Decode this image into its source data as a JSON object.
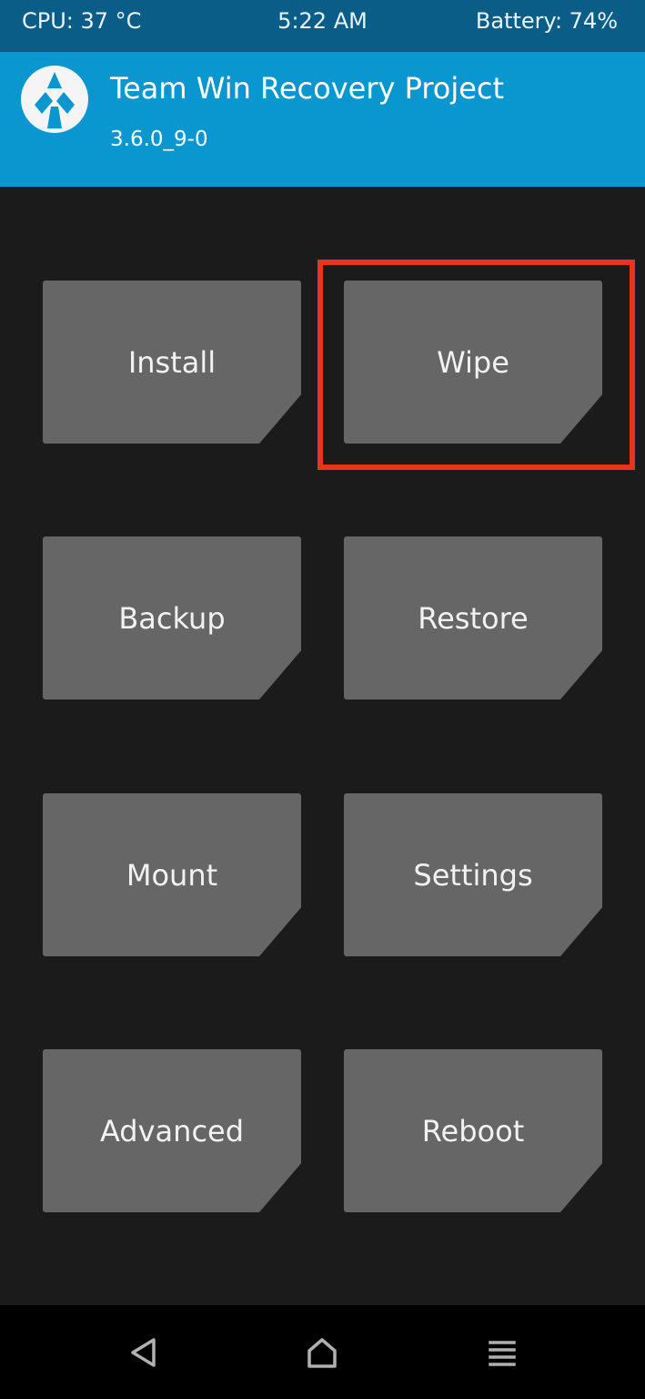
{
  "status_bar": {
    "cpu": "CPU: 37 °C",
    "time": "5:22 AM",
    "battery": "Battery: 74%"
  },
  "header": {
    "logo_icon": "twrp-logo-icon",
    "title": "Team Win Recovery Project",
    "version": "3.6.0_9-0"
  },
  "menu": {
    "install": "Install",
    "wipe": "Wipe",
    "backup": "Backup",
    "restore": "Restore",
    "mount": "Mount",
    "settings": "Settings",
    "advanced": "Advanced",
    "reboot": "Reboot"
  },
  "highlight": {
    "target": "wipe",
    "color": "#e8341c"
  },
  "nav_bar": {
    "back_icon": "back-triangle-icon",
    "home_icon": "home-icon",
    "menu_icon": "menu-lines-icon"
  },
  "colors": {
    "status_bar": "#0a5d86",
    "header": "#0a96cf",
    "background": "#1b1b1b",
    "tile": "#666666",
    "nav_bar": "#000000"
  }
}
